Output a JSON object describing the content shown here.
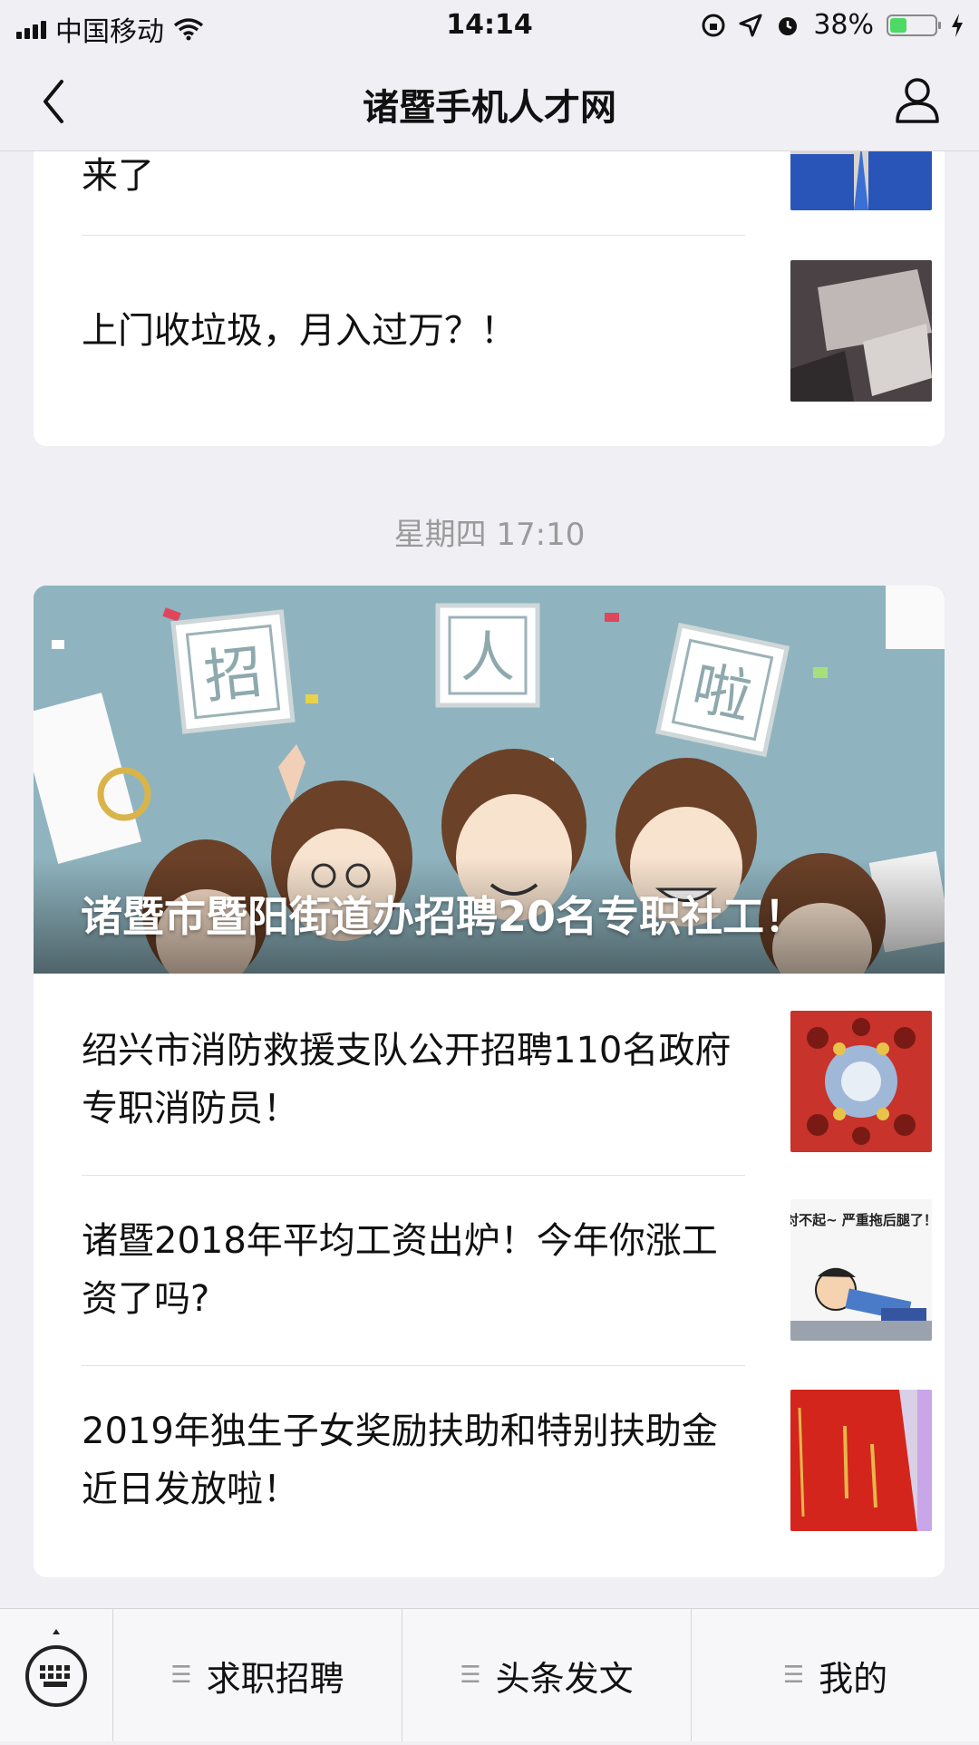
{
  "status_bar": {
    "carrier": "中国移动",
    "time": "14:14",
    "battery": "38%",
    "battery_level": 0.38
  },
  "nav": {
    "title": "诸暨手机人才网"
  },
  "top_card": {
    "items": [
      {
        "title": "来了"
      },
      {
        "title": "上门收垃圾，月入过万？！"
      }
    ]
  },
  "timestamp": "星期四 17:10",
  "main_card": {
    "cover": {
      "title": "诸暨市暨阳街道办招聘20名专职社工！",
      "stamps": [
        "招",
        "人",
        "啦"
      ]
    },
    "items": [
      {
        "title": "绍兴市消防救援支队公开招聘110名政府专职消防员！"
      },
      {
        "title": "诸暨2018年平均工资出炉！今年你涨工资了吗?",
        "thumb_text": "对不起~ 严重拖后腿了！"
      },
      {
        "title": "2019年独生子女奖励扶助和特别扶助金近日发放啦！"
      }
    ]
  },
  "tab_bar": {
    "tabs": [
      {
        "label": "求职招聘"
      },
      {
        "label": "头条发文"
      },
      {
        "label": "我的"
      }
    ]
  },
  "colors": {
    "background": "#efeff4",
    "battery_fill": "#4cd964"
  }
}
